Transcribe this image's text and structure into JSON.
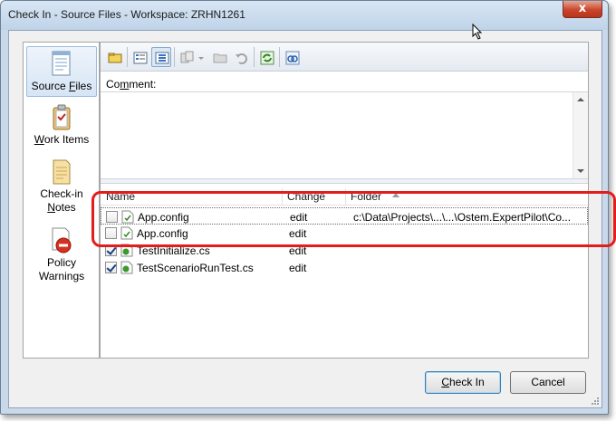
{
  "window": {
    "title": "Check In - Source Files - Workspace: ZRHN1261",
    "close_glyph": "x"
  },
  "sidebar": {
    "items": [
      {
        "label_pre": "Source ",
        "label_u": "F",
        "label_post": "iles",
        "icon": "source-files-icon"
      },
      {
        "label_pre": "",
        "label_u": "W",
        "label_post": "ork Items",
        "icon": "work-items-icon"
      },
      {
        "label_line1": "Check-in",
        "label_pre": "",
        "label_u": "N",
        "label_post": "otes",
        "icon": "check-in-notes-icon"
      },
      {
        "label_line1": "Policy",
        "label_pre": "Warnings",
        "label_u": "",
        "label_post": "",
        "icon": "policy-warnings-icon"
      }
    ]
  },
  "toolbar": {
    "buttons": [
      "shelve-icon",
      "flat-view-icon",
      "tree-view-icon",
      "compare-icon",
      "folder-icon",
      "undo-icon",
      "refresh-icon",
      "link-icon"
    ]
  },
  "comment": {
    "label_pre": "Co",
    "label_u": "m",
    "label_post": "ment:",
    "value": ""
  },
  "file_list": {
    "columns": {
      "name": "Name",
      "change": "Change",
      "folder": "Folder"
    },
    "rows": [
      {
        "name": "App.config",
        "change": "edit",
        "folder": "c:\\Data\\Projects\\...\\...\\Ostem.ExpertPilot\\Co...",
        "checked": false,
        "focused": true
      },
      {
        "name": "App.config",
        "change": "edit",
        "folder": "",
        "checked": false,
        "focused": false
      },
      {
        "name": "TestInitialize.cs",
        "change": "edit",
        "folder": "",
        "checked": true,
        "focused": false
      },
      {
        "name": "TestScenarioRunTest.cs",
        "change": "edit",
        "folder": "",
        "checked": true,
        "focused": false
      }
    ]
  },
  "buttons": {
    "checkin_u": "C",
    "checkin_post": "heck In",
    "cancel": "Cancel"
  },
  "colors": {
    "annotation": "#e41c1c",
    "accent": "#3c7fb1"
  }
}
